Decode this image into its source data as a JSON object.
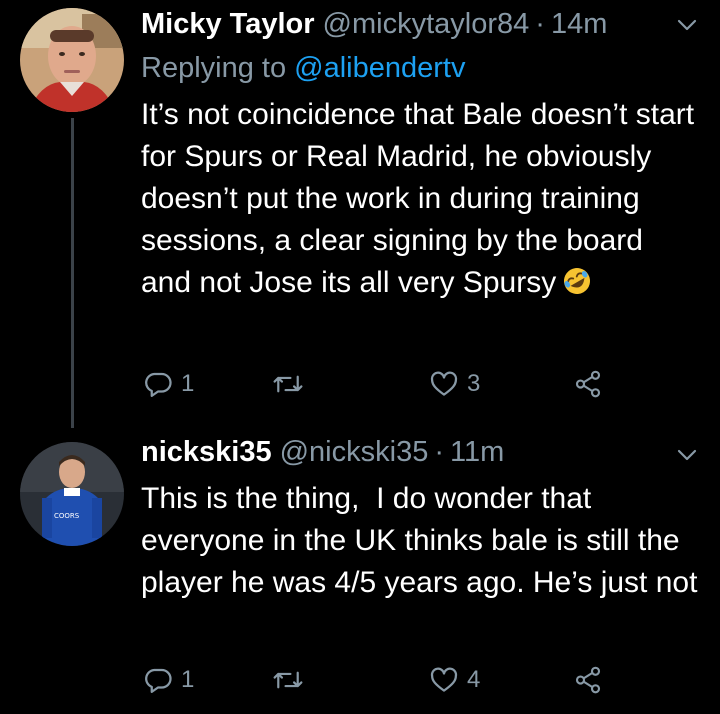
{
  "tweets": [
    {
      "name": "Micky Taylor",
      "handle": "@mickytaylor84",
      "separator": "·",
      "time": "14m",
      "replying_prefix": "Replying to ",
      "replying_to": "@alibendertv",
      "text": "It’s not coincidence that Bale doesn’t start for Spurs or Real Madrid, he obviously doesn’t put the work in during training sessions, a clear signing by the board and not Jose its all very Spursy",
      "emoji": "rolling-on-floor-laughing-emoji",
      "replies": "1",
      "retweets": "",
      "likes": "3"
    },
    {
      "name": "nickski35",
      "handle": "@nickski35",
      "separator": "·",
      "time": "11m",
      "text": "This is the thing,  I do wonder that everyone in the UK thinks bale is still the player he was 4/5 years ago. He’s just not",
      "replies": "1",
      "retweets": "",
      "likes": "4"
    }
  ],
  "colors": {
    "background": "#000000",
    "text": "#ffffff",
    "secondary": "#8899a6",
    "link": "#1da1f2",
    "thread_line": "#3b4249"
  },
  "icons": [
    "chevron-down-icon",
    "reply-icon",
    "retweet-icon",
    "like-icon",
    "share-icon"
  ]
}
